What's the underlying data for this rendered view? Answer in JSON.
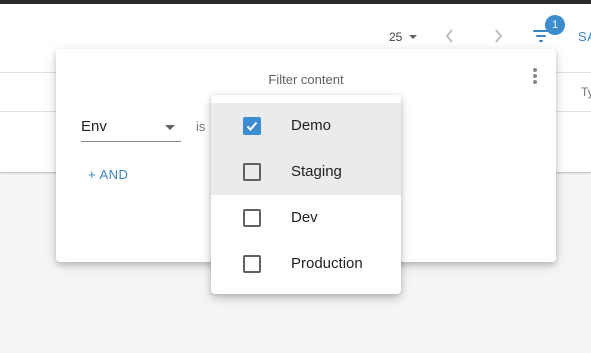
{
  "toolbar": {
    "rows_per_page": "25",
    "filter_count": "1",
    "save_label": "SA",
    "column_header": "Ty"
  },
  "filter_panel": {
    "title": "Filter content",
    "field": "Env",
    "operator": "is",
    "add_label": "+ AND"
  },
  "dropdown": {
    "options": [
      {
        "label": "Demo",
        "checked": true
      },
      {
        "label": "Staging",
        "checked": false
      },
      {
        "label": "Dev",
        "checked": false
      },
      {
        "label": "Production",
        "checked": false
      }
    ]
  },
  "colors": {
    "accent": "#3b82c4",
    "badge": "#3b8dd0",
    "highlight": "#ebebeb"
  },
  "icons": [
    "chevron-down-icon",
    "chevron-left-icon",
    "chevron-right-icon",
    "filter-icon",
    "more-vert-icon",
    "check-icon"
  ]
}
